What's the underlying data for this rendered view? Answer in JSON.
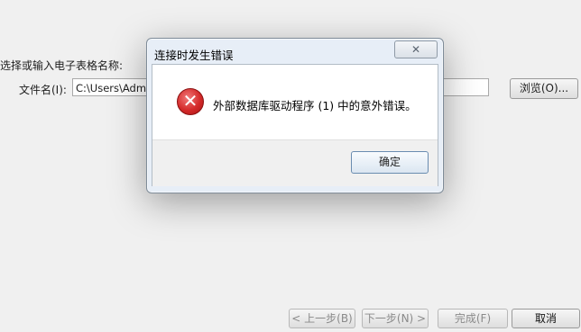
{
  "wizard": {
    "prompt": "选择或输入电子表格名称:",
    "filename_label": "文件名(I):",
    "filename_value": "C:\\Users\\Administrator\\Desktop\\数据.xlsx",
    "browse_label": "浏览(O)...",
    "back_label": "< 上一步(B)",
    "next_label": "下一步(N) >",
    "finish_label": "完成(F)",
    "cancel_label": "取消"
  },
  "dialog": {
    "title": "连接时发生错误",
    "close_glyph": "✕",
    "error_glyph": "✕",
    "message": "外部数据库驱动程序 (1) 中的意外错误。",
    "ok_label": "确定"
  },
  "icons": {
    "dialog": "error-icon",
    "close": "close-icon"
  }
}
